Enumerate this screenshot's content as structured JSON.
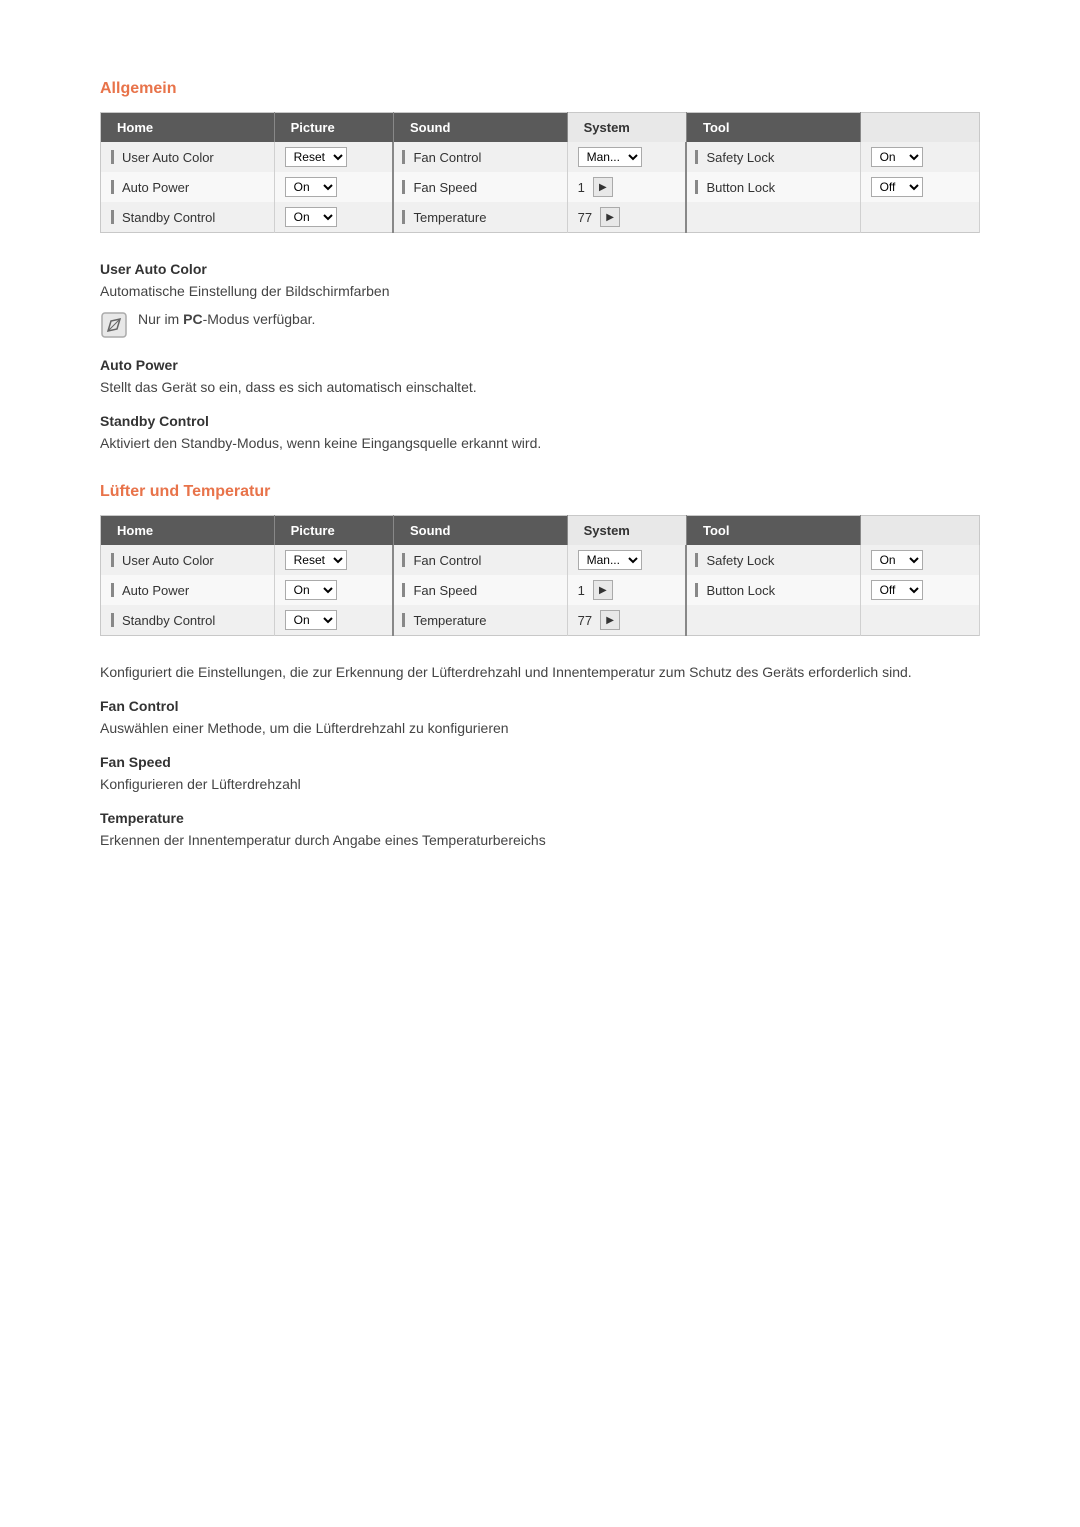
{
  "sections": [
    {
      "id": "allgemein",
      "title": "Allgemein",
      "tabs": [
        "Home",
        "Picture",
        "Sound",
        "System",
        "Tool"
      ],
      "active_tab": "System",
      "table_rows": [
        {
          "col1_label": "User Auto Color",
          "col2_value": "Reset",
          "col2_type": "dropdown",
          "col3_label": "Fan Control",
          "col4_value": "Man...",
          "col4_type": "dropdown",
          "col5_label": "Safety Lock",
          "col6_value": "On",
          "col6_type": "dropdown"
        },
        {
          "col1_label": "Auto Power",
          "col2_value": "On",
          "col2_type": "dropdown",
          "col3_label": "Fan Speed",
          "col4_value": "1",
          "col4_type": "arrow",
          "col5_label": "Button Lock",
          "col6_value": "Off",
          "col6_type": "dropdown"
        },
        {
          "col1_label": "Standby Control",
          "col2_value": "On",
          "col2_type": "dropdown",
          "col3_label": "Temperature",
          "col4_value": "77",
          "col4_type": "arrow",
          "col5_label": "",
          "col6_value": "",
          "col6_type": ""
        }
      ],
      "items": [
        {
          "heading": "User Auto Color",
          "description": "Automatische Einstellung der Bildschirmfarben",
          "note": "Nur im PC-Modus verfügbar.",
          "has_note": true
        },
        {
          "heading": "Auto Power",
          "description": "Stellt das Gerät so ein, dass es sich automatisch einschaltet.",
          "has_note": false
        },
        {
          "heading": "Standby Control",
          "description": "Aktiviert den Standby-Modus, wenn keine Eingangsquelle erkannt wird.",
          "has_note": false
        }
      ]
    },
    {
      "id": "luefter",
      "title": "Lüfter und Temperatur",
      "tabs": [
        "Home",
        "Picture",
        "Sound",
        "System",
        "Tool"
      ],
      "active_tab": "System",
      "table_rows": [
        {
          "col1_label": "User Auto Color",
          "col2_value": "Reset",
          "col2_type": "dropdown",
          "col3_label": "Fan Control",
          "col4_value": "Man...",
          "col4_type": "dropdown",
          "col5_label": "Safety Lock",
          "col6_value": "On",
          "col6_type": "dropdown"
        },
        {
          "col1_label": "Auto Power",
          "col2_value": "On",
          "col2_type": "dropdown",
          "col3_label": "Fan Speed",
          "col4_value": "1",
          "col4_type": "arrow",
          "col5_label": "Button Lock",
          "col6_value": "Off",
          "col6_type": "dropdown"
        },
        {
          "col1_label": "Standby Control",
          "col2_value": "On",
          "col2_type": "dropdown",
          "col3_label": "Temperature",
          "col4_value": "77",
          "col4_type": "arrow",
          "col5_label": "",
          "col6_value": "",
          "col6_type": ""
        }
      ],
      "intro": "Konfiguriert die Einstellungen, die zur Erkennung der Lüfterdrehzahl und Innentemperatur zum Schutz des Geräts erforderlich sind.",
      "items": [
        {
          "heading": "Fan Control",
          "description": "Auswählen einer Methode, um die Lüfterdrehzahl zu konfigurieren",
          "has_note": false
        },
        {
          "heading": "Fan Speed",
          "description": "Konfigurieren der Lüfterdrehzahl",
          "has_note": false
        },
        {
          "heading": "Temperature",
          "description": "Erkennen der Innentemperatur durch Angabe eines Temperaturbereichs",
          "has_note": false
        }
      ]
    }
  ],
  "note_icon_label": "note-icon",
  "tabs_order": [
    "Home",
    "Picture",
    "Sound",
    "System",
    "Tool"
  ]
}
